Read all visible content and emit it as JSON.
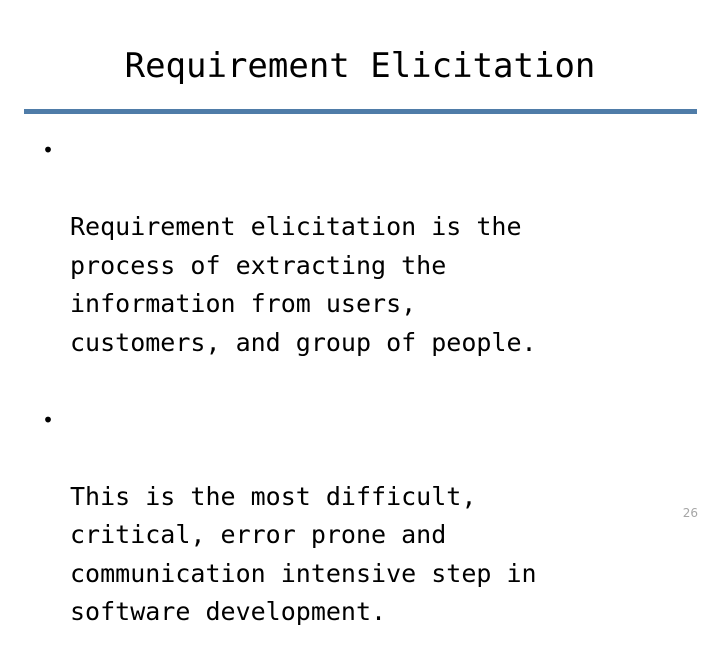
{
  "slide": {
    "title": "Requirement Elicitation",
    "page_number": "26",
    "accent_color": "#4f7ca8",
    "text_color": "#000000",
    "background_color": "#ffffff",
    "page_number_color": "#a6a6a6",
    "bullets": [
      {
        "marker": "•",
        "text": "Requirement elicitation is the\nprocess of extracting the\ninformation from users,\ncustomers, and group of people."
      },
      {
        "marker": "•",
        "text": "This is the most difficult,\ncritical, error prone and\ncommunication intensive step in\nsoftware development."
      }
    ]
  }
}
